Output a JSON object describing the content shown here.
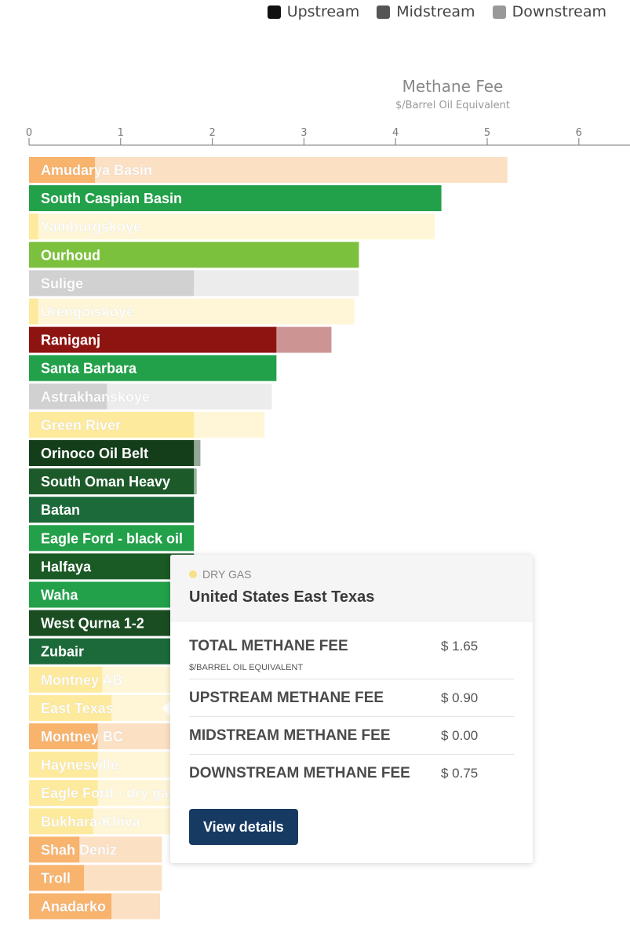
{
  "legend": [
    {
      "label": "Upstream",
      "color": "#111111"
    },
    {
      "label": "Midstream",
      "color": "#555555"
    },
    {
      "label": "Downstream",
      "color": "#999999"
    }
  ],
  "chart_data": {
    "type": "bar",
    "orientation": "horizontal",
    "stacked": true,
    "title": "Methane Fee",
    "subtitle": "$/Barrel Oil Equivalent",
    "xlim": [
      0,
      6.6
    ],
    "xticks": [
      0,
      1,
      2,
      3,
      4,
      5,
      6
    ],
    "bars": [
      {
        "name": "Amudarya Basin",
        "upstream": 0.72,
        "midstream": 0,
        "downstream": 4.5,
        "color": "#f7a654",
        "faded": true
      },
      {
        "name": "South Caspian Basin",
        "upstream": 4.5,
        "midstream": 0,
        "downstream": 0,
        "color": "#23a04a",
        "faded": false
      },
      {
        "name": "Yamburgskoye",
        "upstream": 0.1,
        "midstream": 0,
        "downstream": 4.33,
        "color": "#fde68c",
        "faded": true
      },
      {
        "name": "Ourhoud",
        "upstream": 3.6,
        "midstream": 0,
        "downstream": 0,
        "color": "#7cc13e",
        "faded": false
      },
      {
        "name": "Sulige",
        "upstream": 1.8,
        "midstream": 0,
        "downstream": 1.8,
        "color": "#c9c9c9",
        "faded": true
      },
      {
        "name": "Urengoiskoye",
        "upstream": 0.1,
        "midstream": 0,
        "downstream": 3.45,
        "color": "#fde68c",
        "faded": true
      },
      {
        "name": "Raniganj",
        "upstream": 2.7,
        "midstream": 0,
        "downstream": 0.6,
        "color": "#8e1411",
        "faded": false
      },
      {
        "name": "Santa Barbara",
        "upstream": 2.7,
        "midstream": 0,
        "downstream": 0,
        "color": "#23a04a",
        "faded": false
      },
      {
        "name": "Astrakhanskoye",
        "upstream": 0.85,
        "midstream": 0,
        "downstream": 1.8,
        "color": "#c9c9c9",
        "faded": true
      },
      {
        "name": "Green River",
        "upstream": 1.8,
        "midstream": 0,
        "downstream": 0.77,
        "color": "#fde68c",
        "faded": true
      },
      {
        "name": "Orinoco Oil Belt",
        "upstream": 1.8,
        "midstream": 0,
        "downstream": 0.07,
        "color": "#143d1a",
        "faded": false
      },
      {
        "name": "South Oman Heavy",
        "upstream": 1.8,
        "midstream": 0,
        "downstream": 0.03,
        "color": "#1d5a2a",
        "faded": false
      },
      {
        "name": "Batan",
        "upstream": 1.8,
        "midstream": 0,
        "downstream": 0,
        "color": "#1c6a3a",
        "faded": false
      },
      {
        "name": "Eagle Ford - black oil",
        "upstream": 1.8,
        "midstream": 0,
        "downstream": 0,
        "color": "#23a04a",
        "faded": false
      },
      {
        "name": "Halfaya",
        "upstream": 1.8,
        "midstream": 0,
        "downstream": 0,
        "color": "#1a5a24",
        "faded": false
      },
      {
        "name": "Waha",
        "upstream": 1.8,
        "midstream": 0,
        "downstream": 0,
        "color": "#23a04a",
        "faded": false
      },
      {
        "name": "West Qurna 1-2",
        "upstream": 1.8,
        "midstream": 0,
        "downstream": 0,
        "color": "#1a4d22",
        "faded": false
      },
      {
        "name": "Zubair",
        "upstream": 1.8,
        "midstream": 0,
        "downstream": 0,
        "color": "#1c6a3a",
        "faded": false
      },
      {
        "name": "Montney AB",
        "upstream": 0.8,
        "midstream": 0,
        "downstream": 0.9,
        "color": "#fde68c",
        "faded": true
      },
      {
        "name": "East Texas",
        "upstream": 0.9,
        "midstream": 0,
        "downstream": 0.75,
        "color": "#fde68c",
        "faded": true
      },
      {
        "name": "Montney BC",
        "upstream": 0.75,
        "midstream": 0,
        "downstream": 0.9,
        "color": "#f7a654",
        "faded": true
      },
      {
        "name": "Haynesville",
        "upstream": 0.75,
        "midstream": 0,
        "downstream": 0.9,
        "color": "#fde68c",
        "faded": true
      },
      {
        "name": "Eagle Ford - dry gas",
        "upstream": 0.75,
        "midstream": 0,
        "downstream": 0.9,
        "color": "#fde68c",
        "faded": true
      },
      {
        "name": "Bukhara-Khiva",
        "upstream": 0.7,
        "midstream": 0,
        "downstream": 0.95,
        "color": "#fde68c",
        "faded": true
      },
      {
        "name": "Shah Deniz",
        "upstream": 0.55,
        "midstream": 0,
        "downstream": 0.9,
        "color": "#f7a654",
        "faded": true
      },
      {
        "name": "Troll",
        "upstream": 0.6,
        "midstream": 0,
        "downstream": 0.85,
        "color": "#f7a654",
        "faded": true
      },
      {
        "name": "Anadarko",
        "upstream": 0.9,
        "midstream": 0,
        "downstream": 0.53,
        "color": "#f7a654",
        "faded": true
      }
    ]
  },
  "tooltip": {
    "type": "DRY GAS",
    "title": "United States East Texas",
    "rows": [
      {
        "label": "TOTAL METHANE FEE",
        "value": "$ 1.65",
        "unit": "$/BARREL OIL EQUIVALENT"
      },
      {
        "label": "UPSTREAM METHANE FEE",
        "value": "$ 0.90"
      },
      {
        "label": "MIDSTREAM METHANE FEE",
        "value": "$ 0.00"
      },
      {
        "label": "DOWNSTREAM METHANE FEE",
        "value": "$ 0.75"
      }
    ],
    "button": "View details"
  }
}
